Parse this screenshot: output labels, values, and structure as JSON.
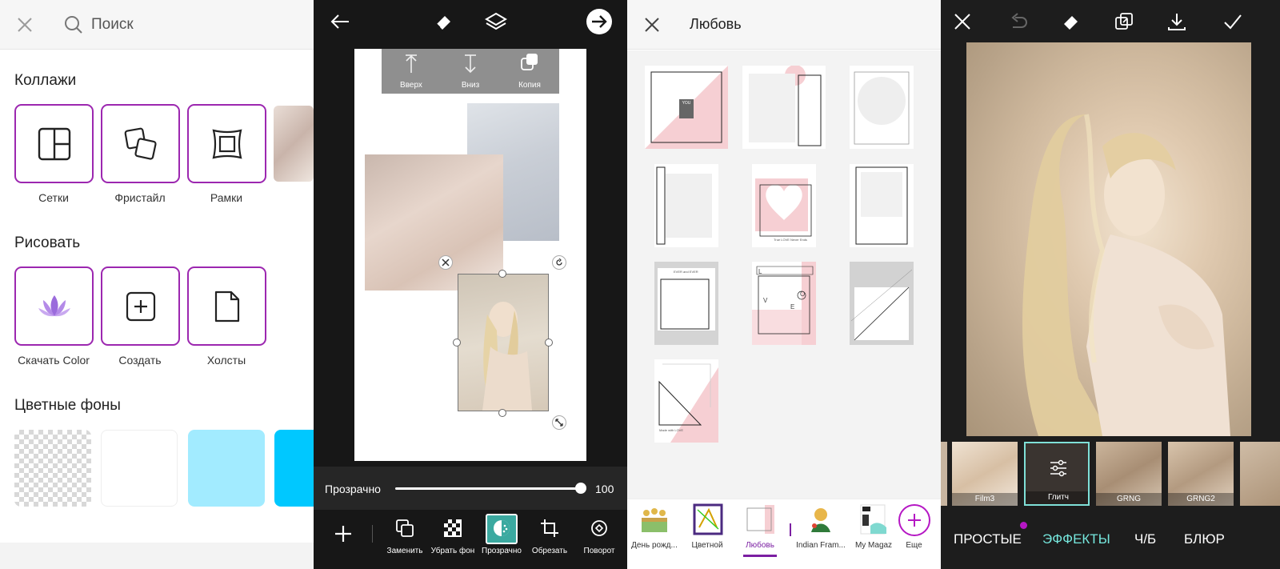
{
  "panel1": {
    "search": {
      "label": "Поиск"
    },
    "sections": {
      "collages": {
        "title": "Коллажи",
        "items": [
          {
            "label": "Сетки"
          },
          {
            "label": "Фристайл"
          },
          {
            "label": "Рамки"
          }
        ]
      },
      "draw": {
        "title": "Рисовать",
        "items": [
          {
            "label": "Скачать Color"
          },
          {
            "label": "Создать"
          },
          {
            "label": "Холсты"
          }
        ]
      },
      "backgrounds": {
        "title": "Цветные фоны",
        "colors": [
          "transparent",
          "#ffffff",
          "#a2ebff",
          "#00c8ff"
        ]
      }
    },
    "colors": {
      "accent": "#9c27b0",
      "lotus": "#9b6bdc"
    }
  },
  "panel2": {
    "context_menu": {
      "up": "Вверх",
      "down": "Вниз",
      "copy": "Копия"
    },
    "slider": {
      "label": "Прозрачно",
      "value": "100",
      "fraction": 1.0
    },
    "toolbar": {
      "replace": "Заменить",
      "remove_bg": "Убрать фон",
      "transparent": "Прозрачно",
      "crop": "Обрезать",
      "rotate": "Поворот"
    },
    "colors": {
      "active_tool": "#3ba9a0"
    }
  },
  "panel3": {
    "title": "Любовь",
    "templates": {
      "t1": {
        "text": "YOU"
      },
      "t5": {
        "text": "True LOVE Never Ends"
      },
      "t7": {
        "text": "EVER and EVER"
      },
      "t8": {
        "text_l": "L",
        "text_o": "O",
        "text_v": "V",
        "text_e": "E"
      },
      "t10": {
        "text": "Made with LOVE"
      }
    },
    "tabs": [
      {
        "label": "День рожд..."
      },
      {
        "label": "Цветной"
      },
      {
        "label": "Любовь"
      },
      {
        "label": "Indian Fram..."
      },
      {
        "label": "My Magaz"
      },
      {
        "label": "Еще"
      }
    ],
    "colors": {
      "active": "#7b1fa2",
      "pink": "#f6cfd3"
    }
  },
  "panel4": {
    "filters": [
      {
        "label": "Film3"
      },
      {
        "label": "Глитч"
      },
      {
        "label": "GRNG"
      },
      {
        "label": "GRNG2"
      }
    ],
    "categories": [
      {
        "label": "ПРОСТЫЕ"
      },
      {
        "label": "ЭФФЕКТЫ"
      },
      {
        "label": "Ч/Б"
      },
      {
        "label": "БЛЮР"
      }
    ],
    "colors": {
      "active": "#76e8de",
      "dot": "#b517c4"
    }
  }
}
